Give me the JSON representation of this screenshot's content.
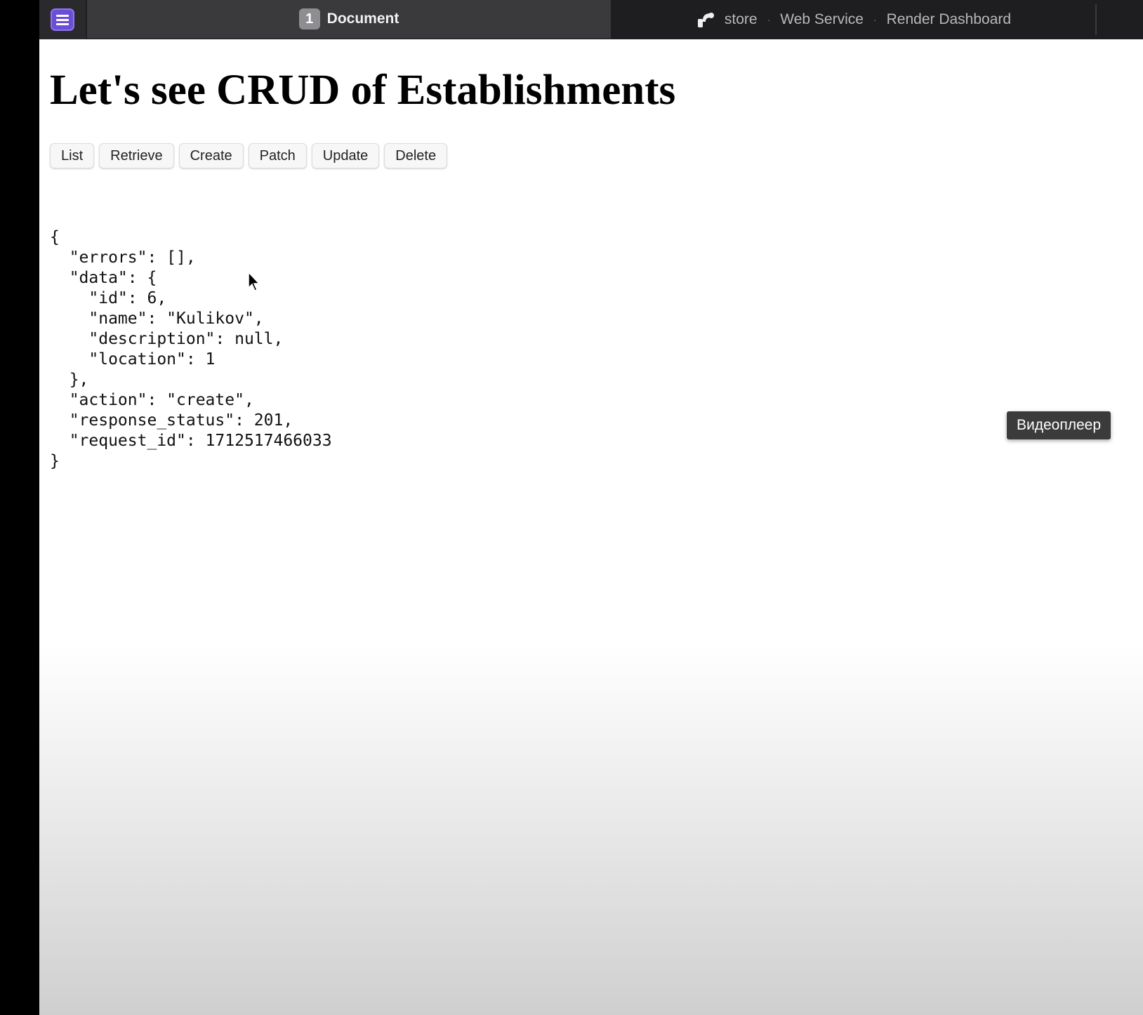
{
  "tabbar": {
    "sidebar_toggle_icon": "list-icon",
    "active_tab": {
      "number": "1",
      "title": "Document"
    },
    "inactive_tab": {
      "icon": "render-logo-icon",
      "parts": [
        "store",
        "Web Service",
        "Render Dashboard"
      ],
      "separator": "·"
    }
  },
  "page": {
    "heading": "Let's see CRUD of Establishments",
    "buttons": [
      "List",
      "Retrieve",
      "Create",
      "Patch",
      "Update",
      "Delete"
    ],
    "json_lines": [
      "{",
      "  \"errors\": [],",
      "  \"data\": {",
      "    \"id\": 6,",
      "    \"name\": \"Kulikov\",",
      "    \"description\": null,",
      "    \"location\": 1",
      "  },",
      "  \"action\": \"create\",",
      "  \"response_status\": 201,",
      "  \"request_id\": 1712517466033",
      "}"
    ]
  },
  "tooltip": {
    "text": "Видеоплеер"
  },
  "colors": {
    "accent": "#6a4ed6",
    "tabbar_bg": "#1e1e20",
    "active_tab_bg": "#3a3a3c"
  }
}
